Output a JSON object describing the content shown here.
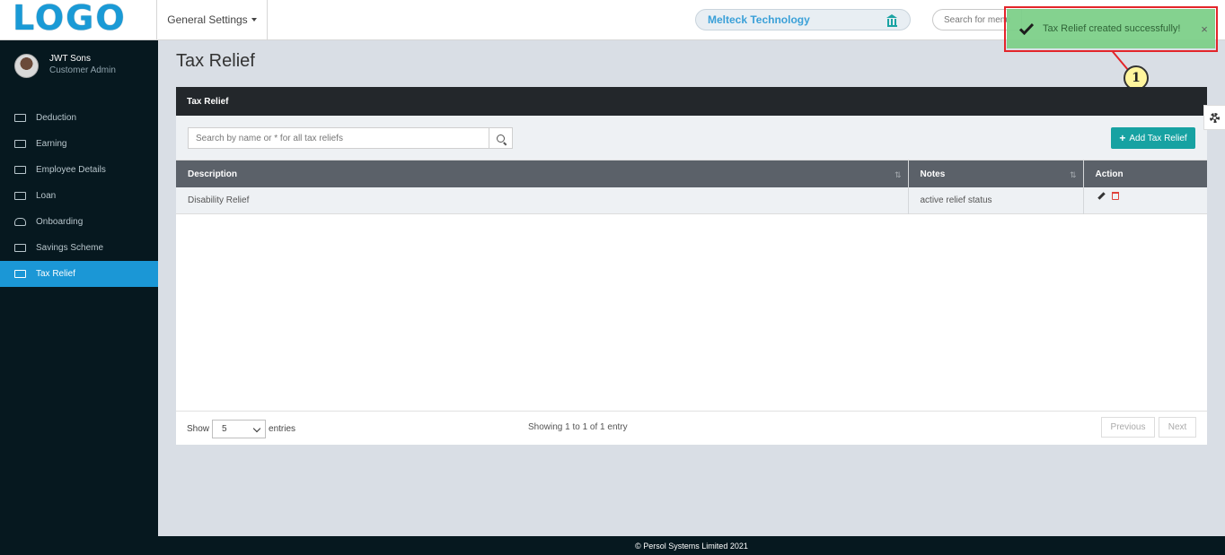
{
  "header": {
    "logo": "LOGO",
    "menu_label": "General Settings",
    "company": "Melteck Technology",
    "search_placeholder": "Search for menu"
  },
  "toast": {
    "message": "Tax Relief created successfully!",
    "close": "×",
    "callout_number": "1",
    "color": "#7ed08a"
  },
  "user": {
    "name": "JWT Sons",
    "role": "Customer Admin"
  },
  "sidebar": {
    "items": [
      {
        "label": "Deduction",
        "icon": "minus-square-icon"
      },
      {
        "label": "Earning",
        "icon": "money-icon"
      },
      {
        "label": "Employee Details",
        "icon": "id-card-icon"
      },
      {
        "label": "Loan",
        "icon": "money-icon"
      },
      {
        "label": "Onboarding",
        "icon": "cloud-upload-icon"
      },
      {
        "label": "Savings Scheme",
        "icon": "money-icon"
      },
      {
        "label": "Tax Relief",
        "icon": "money-icon",
        "active": true
      }
    ],
    "active_color": "#1b97d6"
  },
  "page": {
    "title": "Tax Relief"
  },
  "panel": {
    "title": "Tax Relief",
    "search_placeholder": "Search by name or * for all tax reliefs",
    "add_button": "Add Tax Relief",
    "add_button_color": "#17a2a2",
    "columns": [
      "Description",
      "Notes",
      "Action"
    ],
    "rows": [
      {
        "description": "Disability Relief",
        "notes": "active relief status"
      }
    ],
    "show_label": "Show",
    "page_size": "5",
    "entries_label": "entries",
    "info": "Showing 1 to 1 of 1 entry",
    "previous": "Previous",
    "next": "Next"
  },
  "footer": {
    "copyright": "© Persol Systems Limited 2021"
  }
}
